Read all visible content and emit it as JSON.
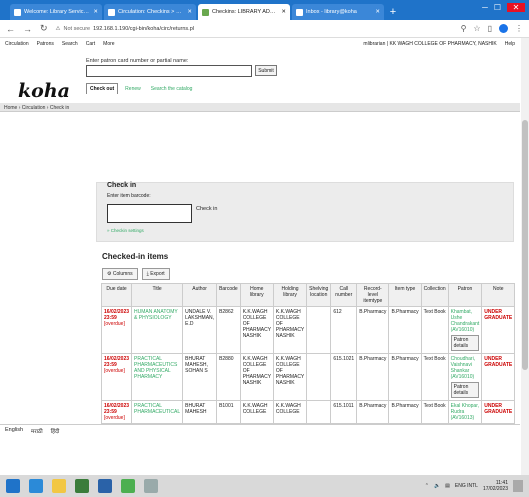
{
  "browser": {
    "tabs": [
      {
        "title": "Welcome: Library Services - Li",
        "active": false
      },
      {
        "title": "Circulation: Checkins > Patron",
        "active": false
      },
      {
        "title": "Checkins: LIBRARY ADMIN",
        "active": true
      },
      {
        "title": "Inbox - library@koha",
        "active": false
      }
    ],
    "url": "192.168.1.190/cgi-bin/koha/circ/returns.pl",
    "url_prefix": "Not secure"
  },
  "koha_nav": {
    "items": [
      "Circulation",
      "Patrons",
      "Search",
      "Cart",
      "More"
    ],
    "right": [
      "mlibrarian | KK WAGH COLLEGE OF PHARMACY, NASHIK",
      "Help"
    ]
  },
  "header": {
    "logo": "koha",
    "scan_label": "Enter patron card number or partial name:",
    "submit_label": "Submit",
    "tabs": [
      "Check out",
      "Renew",
      "Search the catalog"
    ]
  },
  "breadcrumb": "Home › Circulation › Check in",
  "checkin": {
    "title": "Check in",
    "label": "Enter item barcode:",
    "submit": "Check in",
    "options": "» Checkin settings"
  },
  "checked_in": {
    "title": "Checked-in items",
    "buttons": [
      "Columns",
      "Export"
    ],
    "columns": [
      "Due date",
      "Title",
      "Author",
      "Barcode",
      "Home library",
      "Holding library",
      "Shelving location",
      "Call number",
      "Record-level itemtype",
      "Item type",
      "Collection",
      "Patron",
      "Note"
    ],
    "rows": [
      {
        "due": "16/02/2023 23:59",
        "due_extra": "[overdue]",
        "title": "HUMAN ANATOMY & PHYSIOLOGY",
        "author": "UNDALE V. LAKSHMAN, E.D",
        "barcode": "B2862",
        "home": "K.K.WAGH COLLEGE OF PHARMACY NASHIK",
        "holding": "K.K.WAGH COLLEGE OF PHARMACY NASHIK",
        "shelving": "",
        "call": "612",
        "record_type": "B.Pharmacy",
        "item_type": "B.Pharmacy",
        "collection": "Text Book",
        "patron": "Khambat, Ushe Chandrakant (AV16010)",
        "patron_btn": "Patron details",
        "note": "UNDER GRADUATE"
      },
      {
        "due": "16/02/2023 23:59",
        "due_extra": "[overdue]",
        "title": "PRACTICAL PHARMACEUTICS AND PHYSICAL PHARMACY",
        "author": "BHURAT MAHESH, SOHAN S",
        "barcode": "B2880",
        "home": "K.K.WAGH COLLEGE OF PHARMACY NASHIK",
        "holding": "K.K.WAGH COLLEGE OF PHARMACY NASHIK",
        "shelving": "",
        "call": "615.1021",
        "record_type": "B.Pharmacy",
        "item_type": "B.Pharmacy",
        "collection": "Text Book",
        "patron": "Choudhari, Vaishnavi Shankar (AV16010)",
        "patron_btn": "Patron details",
        "note": "UNDER GRADUATE"
      },
      {
        "due": "16/02/2023 23:59",
        "due_extra": "[overdue]",
        "title": "PRACTICAL PHARMACEUTICAL",
        "author": "BHURAT MAHESH",
        "barcode": "B1001",
        "home": "K.K.WAGH COLLEGE",
        "holding": "K.K.WAGH COLLEGE",
        "shelving": "",
        "call": "615.1011",
        "record_type": "B.Pharmacy",
        "item_type": "B.Pharmacy",
        "collection": "Text Book",
        "patron": "Ekal Khopar, Rudra (AV16013)",
        "patron_btn": "",
        "note": "UNDER GRADUATE"
      }
    ]
  },
  "language_bar": [
    "English",
    "मराठी",
    "हिंदी"
  ],
  "taskbar": {
    "clock_time": "11:41",
    "clock_date": "17/02/2023",
    "lang": "ENG INTL"
  }
}
